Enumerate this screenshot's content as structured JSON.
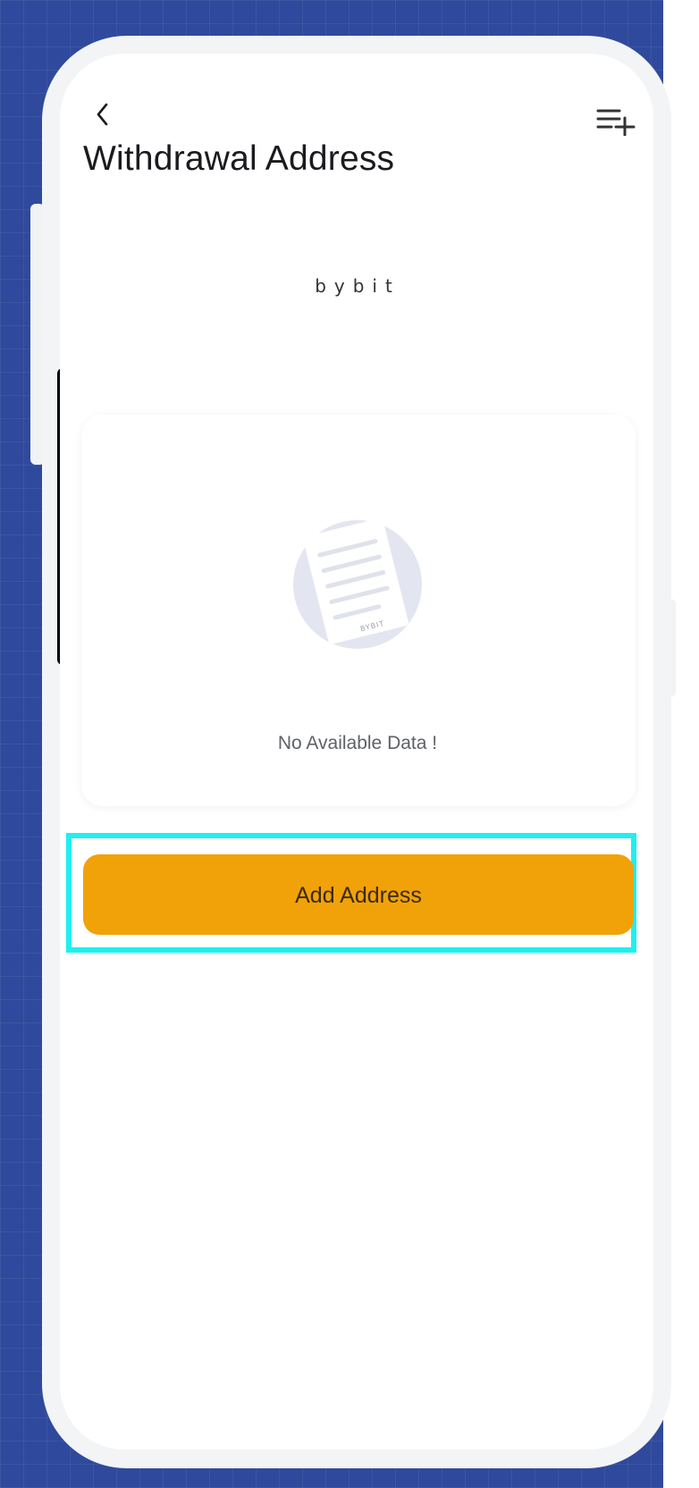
{
  "header": {
    "title": "Withdrawal Address",
    "back_icon": "chevron-left-icon",
    "add_icon": "list-add-icon"
  },
  "brand": {
    "watermark": "bybit",
    "illustration_stamp": "BYBIT"
  },
  "empty_state": {
    "message": "No Available Data !"
  },
  "actions": {
    "add_address_label": "Add Address"
  },
  "colors": {
    "accent": "#f1a208",
    "highlight": "#1ff0ef",
    "backdrop": "#2f4a9c"
  }
}
